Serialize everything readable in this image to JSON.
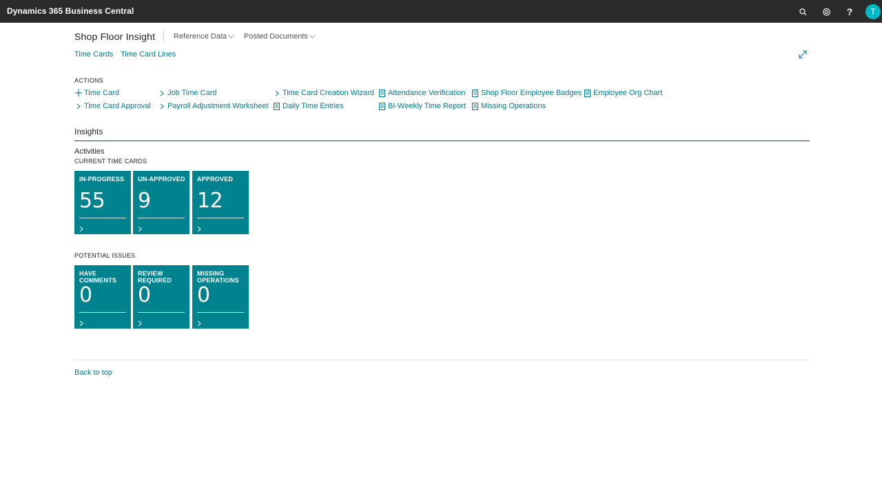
{
  "app": {
    "title": "Dynamics 365 Business Central",
    "avatar_initial": "T"
  },
  "topbar": {
    "icons": [
      "search-icon",
      "gear-icon",
      "help-icon"
    ],
    "help_glyph": "?"
  },
  "header": {
    "title": "Shop Floor Insight",
    "menus": [
      {
        "label": "Reference Data"
      },
      {
        "label": "Posted Documents"
      }
    ],
    "links": [
      {
        "label": "Time Cards"
      },
      {
        "label": "Time Card Lines"
      }
    ]
  },
  "actions": {
    "label": "ACTIONS",
    "items": [
      {
        "label": "Time Card",
        "icon": "plus-icon"
      },
      {
        "label": "Time Card Approval",
        "icon": "chevron-right-icon"
      },
      {
        "label": "Job Time Card",
        "icon": "chevron-right-icon"
      },
      {
        "label": "Payroll Adjustment Worksheet",
        "icon": "chevron-right-icon"
      },
      {
        "label": "Time Card Creation Wizard",
        "icon": "chevron-right-icon"
      },
      {
        "label": "Daily Time Entries",
        "icon": "report-icon"
      },
      {
        "label": "Attendance Verification",
        "icon": "report-icon"
      },
      {
        "label": "BI-Weekly Time Report",
        "icon": "report-icon"
      },
      {
        "label": "Shop Floor Employee Badges",
        "icon": "report-icon"
      },
      {
        "label": "Missing Operations",
        "icon": "report-icon"
      },
      {
        "label": "Employee Org Chart",
        "icon": "report-icon"
      }
    ]
  },
  "insights": {
    "title": "Insights",
    "activities_label": "Activities",
    "groups": [
      {
        "label": "CURRENT TIME CARDS",
        "tiles": [
          {
            "label": "IN-PROGRESS",
            "value": "55"
          },
          {
            "label": "UN-APPROVED",
            "value": "9"
          },
          {
            "label": "APPROVED",
            "value": "12"
          }
        ]
      },
      {
        "label": "POTENTIAL ISSUES",
        "tiles": [
          {
            "label": "HAVE COMMENTS",
            "value": "0"
          },
          {
            "label": "REVIEW REQUIRED",
            "value": "0"
          },
          {
            "label": "MISSING OPERATIONS",
            "value": "0"
          }
        ]
      }
    ]
  },
  "footer": {
    "back_to_top": "Back to top"
  },
  "colors": {
    "topbar": "#2b2b2b",
    "link": "#00788a",
    "tile": "#00828f",
    "avatar": "#00b7c3"
  }
}
